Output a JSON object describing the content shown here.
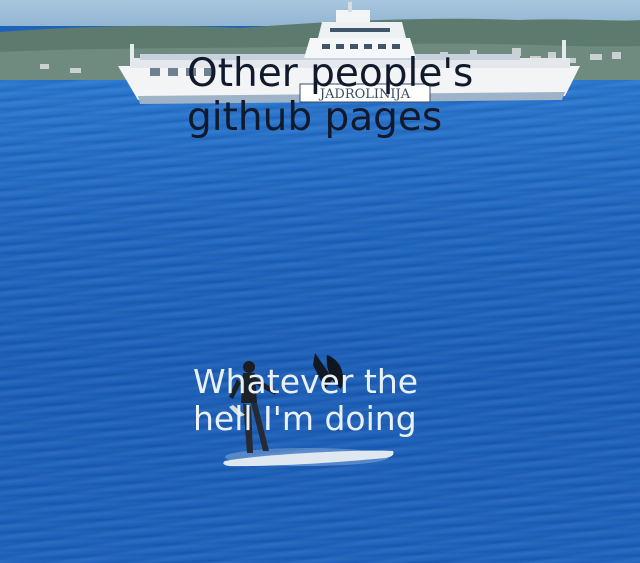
{
  "meme": {
    "top_caption": "Other people's\ngithub pages",
    "bottom_caption": "Whatever the\nhell I'm doing",
    "ship_name": "JADROLINIJA"
  },
  "colors": {
    "sea": "#1f63b8",
    "sky": "#a9c6df",
    "top_caption": "#101a2c",
    "bottom_caption": "#e9f0f6",
    "ship_hull": "#f2f4f6"
  }
}
